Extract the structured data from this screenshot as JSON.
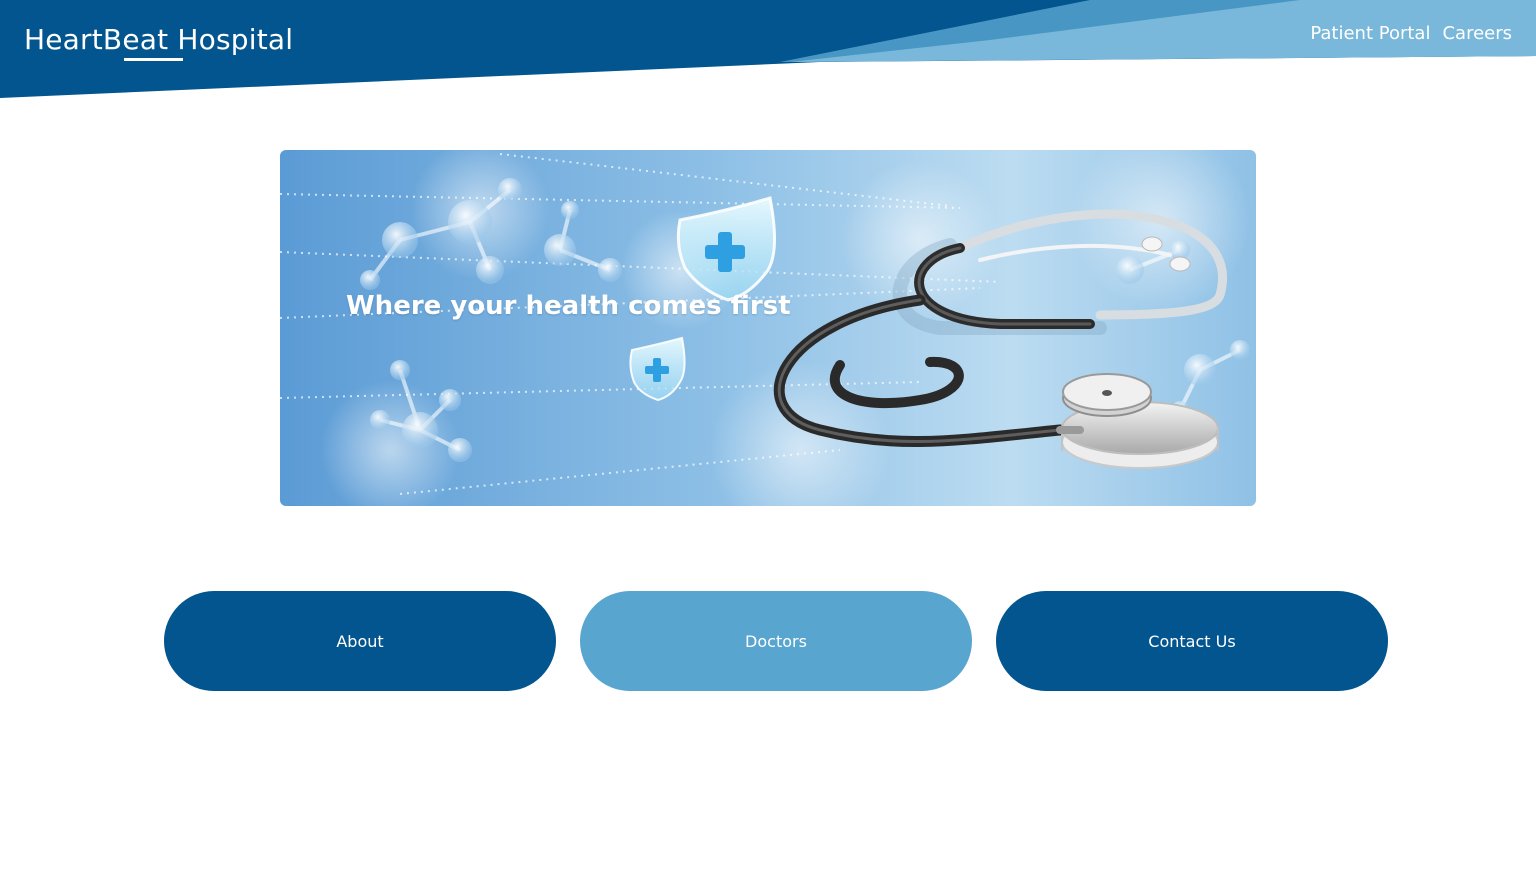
{
  "site": {
    "title": "HeartBeat Hospital"
  },
  "top_nav": {
    "items": [
      {
        "label": "Patient Portal"
      },
      {
        "label": "Careers"
      }
    ]
  },
  "hero": {
    "tagline": "Where your health comes first",
    "image_icons": [
      "shield-cross-icon",
      "stethoscope-icon",
      "molecule-icon"
    ]
  },
  "main_buttons": [
    {
      "label": "About"
    },
    {
      "label": "Doctors"
    },
    {
      "label": "Contact Us"
    }
  ],
  "colors": {
    "brand_dark": "#02558e",
    "brand_light": "#58a5cf",
    "header_light": "#79b8da",
    "background": "#ffffff"
  }
}
